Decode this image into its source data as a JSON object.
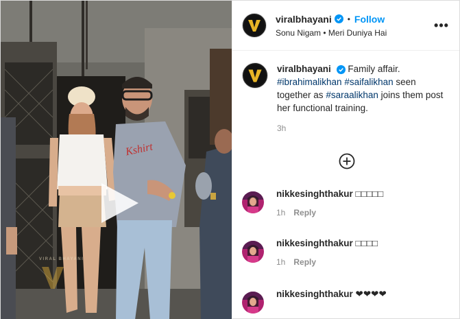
{
  "header": {
    "username": "viralbhayani",
    "separator": "•",
    "follow_label": "Follow",
    "audio": "Sonu Nigam • Meri Duniya Hai",
    "more_label": "•••"
  },
  "caption": {
    "username": "viralbhayani",
    "text_before": "Family affair.",
    "hashtag1": "#ibrahimalikhan",
    "hashtag2": "#saifalikhan",
    "text_mid": "seen together as",
    "hashtag3": "#saraalikhan",
    "text_after": "joins them post her functional training.",
    "time": "3h"
  },
  "comments": [
    {
      "username": "nikkesinghthakur",
      "text": "□□□□□",
      "time": "1h",
      "reply_label": "Reply"
    },
    {
      "username": "nikkesinghthakur",
      "text": "□□□□",
      "time": "1h",
      "reply_label": "Reply"
    },
    {
      "username": "nikkesinghthakur",
      "text": "❤❤❤❤",
      "time": "",
      "reply_label": ""
    }
  ],
  "media": {
    "watermark": "VIRAL BHAYANI",
    "shirt_text": "Kshirt"
  },
  "colors": {
    "link": "#0095f6",
    "hashtag": "#00376b",
    "muted": "#8e8e8e",
    "verified": "#0095f6",
    "logo_gold": "#e8b526"
  },
  "icons": {
    "verified": "verified-badge-icon",
    "more": "more-options-icon",
    "add": "add-circle-icon",
    "play": "play-icon"
  }
}
